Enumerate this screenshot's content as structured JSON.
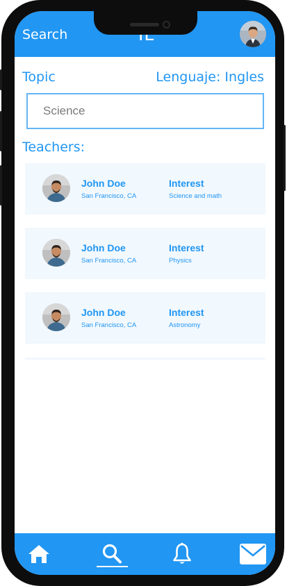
{
  "header": {
    "search_label": "Search",
    "logo": "IL"
  },
  "filters": {
    "topic_label": "Topic",
    "language_label": "Lenguaje: Ingles",
    "search_value": "Science"
  },
  "teachers_label": "Teachers:",
  "teachers": [
    {
      "name": "John Doe",
      "location": "San Francisco, CA",
      "interest_label": "Interest",
      "interest": "Science and math"
    },
    {
      "name": "John Doe",
      "location": "San Francisco, CA",
      "interest_label": "Interest",
      "interest": "Physics"
    },
    {
      "name": "John Doe",
      "location": "San Francisco, CA",
      "interest_label": "Interest",
      "interest": "Astronomy"
    }
  ],
  "tabbar": {
    "items": [
      {
        "icon": "home-icon",
        "active": false
      },
      {
        "icon": "search-icon",
        "active": true
      },
      {
        "icon": "bell-icon",
        "active": false
      },
      {
        "icon": "mail-icon",
        "active": false
      }
    ]
  },
  "colors": {
    "primary": "#2196f3",
    "card_background": "#f1f8fe",
    "input_border": "#64b5f6",
    "phone_frame": "#0d0d0d"
  }
}
